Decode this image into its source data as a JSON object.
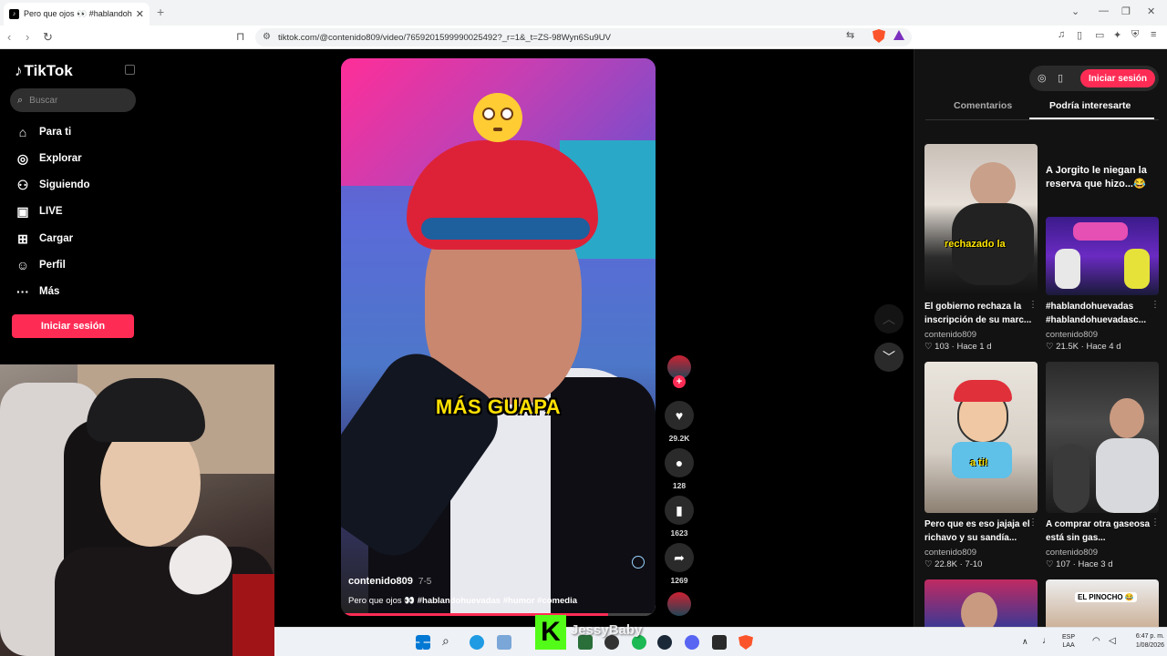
{
  "browser": {
    "tab_title": "Pero que ojos 👀 #hablandohue",
    "url": "tiktok.com/@contenido809/video/7659201599990025492?_r=1&_t=ZS-98Wyn6Su9UV"
  },
  "sidebar": {
    "brand": "TikTok",
    "search_placeholder": "Buscar",
    "items": [
      {
        "label": "Para ti",
        "icon": "home-icon"
      },
      {
        "label": "Explorar",
        "icon": "compass-icon"
      },
      {
        "label": "Siguiendo",
        "icon": "following-icon"
      },
      {
        "label": "LIVE",
        "icon": "live-icon"
      },
      {
        "label": "Cargar",
        "icon": "upload-icon"
      },
      {
        "label": "Perfil",
        "icon": "profile-icon"
      },
      {
        "label": "Más",
        "icon": "more-icon"
      }
    ],
    "login_label": "Iniciar sesión"
  },
  "video": {
    "caption": "MÁS GUAPA",
    "author": "contenido809",
    "date": "7-5",
    "description_prefix": "Pero que ojos 👀",
    "hashtags": "#hablandohuevadas #humor #comedia",
    "progress": 0.85
  },
  "actions": {
    "likes": "29.2K",
    "comments": "128",
    "saves": "1623",
    "shares": "1269"
  },
  "right_panel": {
    "login_label": "Iniciar sesión",
    "tab_comments": "Comentarios",
    "tab_suggested": "Podría interesarte",
    "featured_title": "A Jorgito le niegan la reserva que hizo...😂",
    "cards": [
      {
        "thumb_label": "rechazado la",
        "title": "El gobierno rechaza la inscripción de su marc...",
        "author": "contenido809",
        "likes": "103",
        "when": "Hace 1 d"
      },
      {
        "thumb_label": "",
        "title": "#hablandohuevadas #hablandohuevadasc...",
        "author": "contenido809",
        "likes": "21.5K",
        "when": "Hace 4 d"
      },
      {
        "thumb_label": "a ti!",
        "title": "Pero que es eso jajaja el richavo y su sandía...",
        "author": "contenido809",
        "likes": "22.8K",
        "when": "7-10"
      },
      {
        "thumb_label": "",
        "title": "A comprar otra gaseosa está sin gas...",
        "author": "contenido809",
        "likes": "107",
        "when": "Hace 3 d"
      }
    ],
    "bottom_thumb_label": "EL PINOCHO 😂"
  },
  "stream_overlay": {
    "channel": "JessyBaby"
  },
  "taskbar": {
    "lang_top": "ESP",
    "lang_bottom": "LAA",
    "time": "6:47 p. m.",
    "date": "1/08/2026"
  }
}
